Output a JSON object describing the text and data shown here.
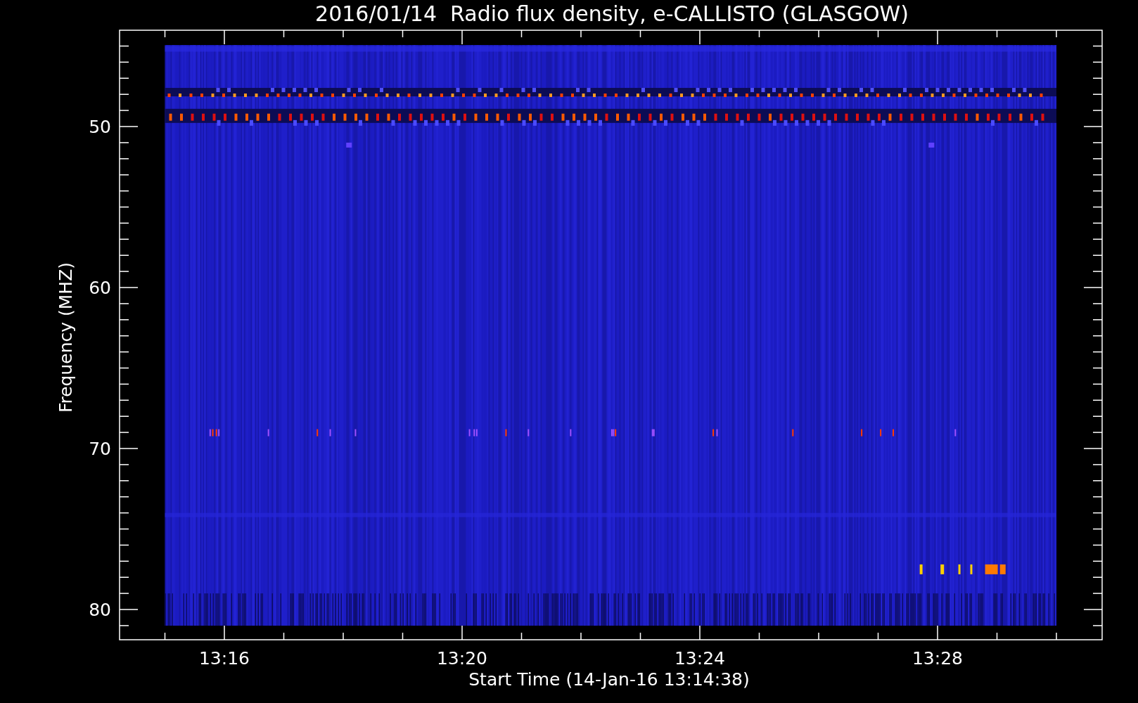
{
  "plot": {
    "title": "2016/01/14  Radio flux density, e-CALLISTO (GLASGOW)",
    "xlabel": "Start Time (14-Jan-16 13:14:38)",
    "ylabel": "Frequency (MHZ)",
    "xticks": [
      "13:16",
      "13:20",
      "13:24",
      "13:28"
    ],
    "yticks": [
      "50",
      "60",
      "70",
      "80"
    ]
  }
}
